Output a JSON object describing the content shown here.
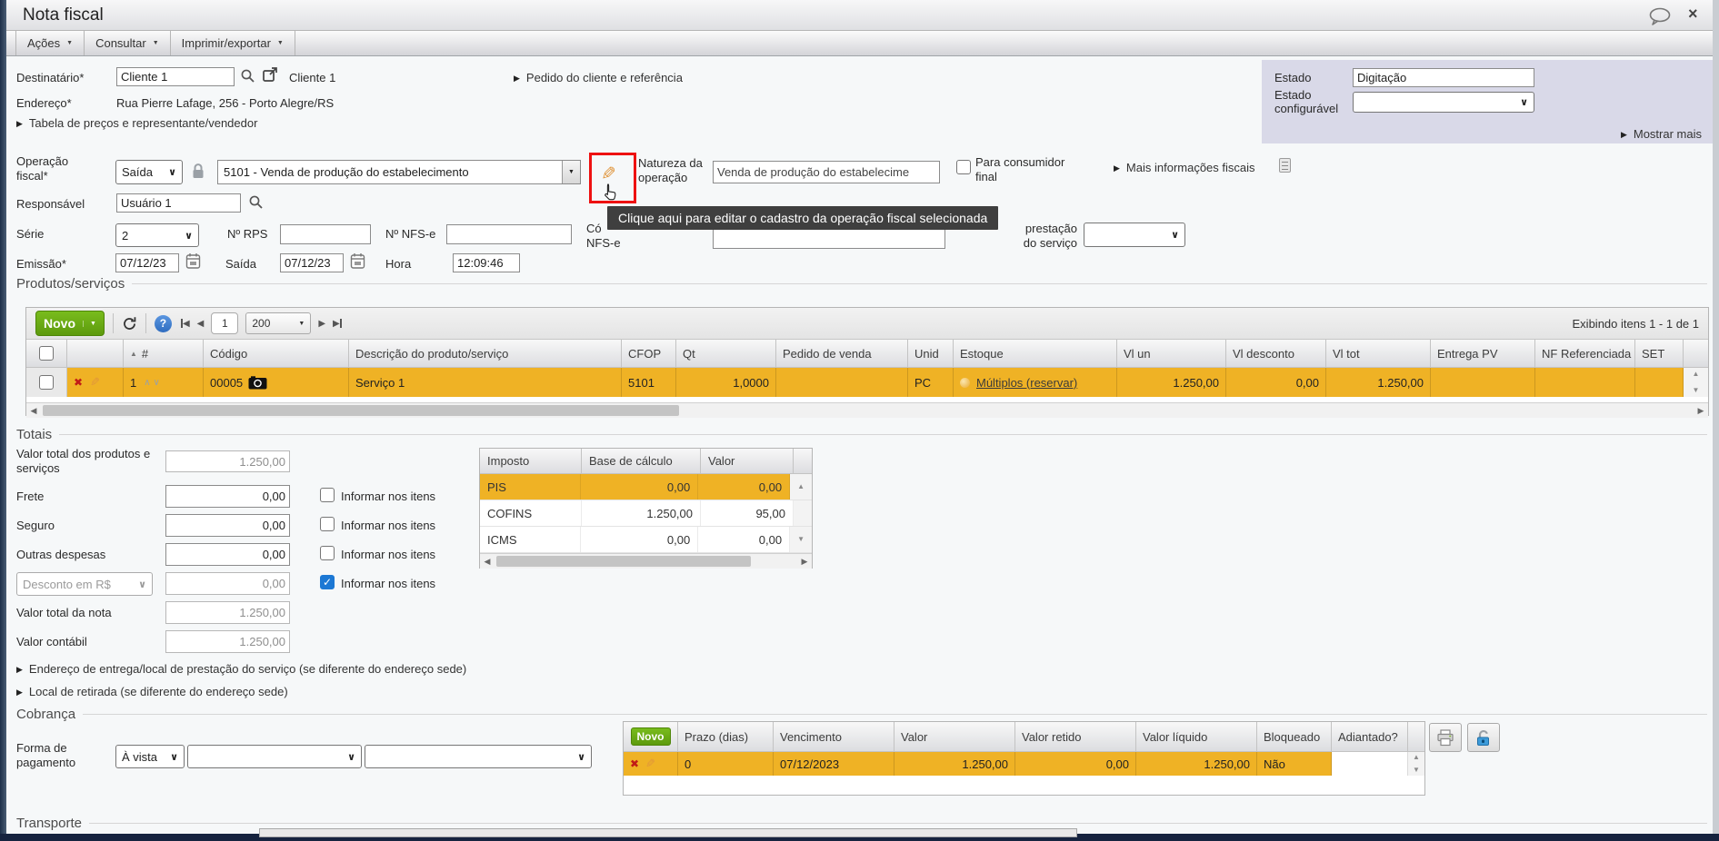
{
  "window": {
    "title": "Nota fiscal",
    "close": "×",
    "menus": [
      "Ações",
      "Consultar",
      "Imprimir/exportar"
    ]
  },
  "header": {
    "destinatario_label": "Destinatário*",
    "destinatario_value": "Cliente 1",
    "destinatario_name": "Cliente 1",
    "pedido_link": "Pedido do cliente e referência",
    "endereco_label": "Endereço*",
    "endereco_value": "Rua Pierre Lafage, 256 - Porto Alegre/RS",
    "tabela_link": "Tabela de preços e representante/vendedor",
    "estado_label": "Estado",
    "estado_value": "Digitação",
    "estado_config_label": "Estado configurável",
    "mostrar_mais": "Mostrar mais"
  },
  "fiscal": {
    "operacao_label": "Operação fiscal*",
    "tipo_value": "Saída",
    "operacao_value": "5101 - Venda de produção do estabelecimento",
    "natureza_label": "Natureza da operação",
    "natureza_value": "Venda de produção do estabelecime",
    "consumidor_label": "Para consumidor final",
    "mais_info_link": "Mais informações fiscais",
    "tooltip": "Clique aqui para editar o cadastro da operação fiscal selecionada",
    "responsavel_label": "Responsável",
    "responsavel_value": "Usuário 1",
    "serie_label": "Série",
    "serie_value": "2",
    "rps_label": "Nº RPS",
    "rps_value": "",
    "nfse_label": "Nº NFS-e",
    "nfse_value": "",
    "codigo_label_line1": "Có",
    "codigo_label_line2": "NFS-e",
    "codigo_value": "",
    "prestacao_label_line1": "prestação",
    "prestacao_label_line2": "do serviço",
    "emissao_label": "Emissão*",
    "emissao_value": "07/12/23",
    "saida_label": "Saída",
    "saida_value": "07/12/23",
    "hora_label": "Hora",
    "hora_value": "12:09:46"
  },
  "produtos": {
    "legend": "Produtos/serviços",
    "novo_label": "Novo",
    "page": "1",
    "page_size": "200",
    "exibindo": "Exibindo itens 1 - 1 de 1",
    "num_header": "#",
    "columns": [
      "Código",
      "Descrição do produto/serviço",
      "CFOP",
      "Qt",
      "Pedido de venda",
      "Unid",
      "Estoque",
      "Vl un",
      "Vl desconto",
      "Vl tot",
      "Entrega PV",
      "NF Referenciada",
      "SET"
    ],
    "row": {
      "num": "1",
      "codigo": "00005",
      "descricao": "Serviço 1",
      "cfop": "5101",
      "qt": "1,0000",
      "pedido": "",
      "unid": "PC",
      "estoque_link": "Múltiplos (reservar)",
      "vl_un": "1.250,00",
      "vl_desconto": "0,00",
      "vl_tot": "1.250,00",
      "entrega_pv": "",
      "nf_ref": "",
      "set": ""
    }
  },
  "totais": {
    "legend": "Totais",
    "valor_total_produtos_label": "Valor total dos produtos e serviços",
    "valor_total_produtos": "1.250,00",
    "frete_label": "Frete",
    "frete": "0,00",
    "seguro_label": "Seguro",
    "seguro": "0,00",
    "outras_label": "Outras despesas",
    "outras": "0,00",
    "desconto_label": "Desconto em R$",
    "desconto": "0,00",
    "informar_label": "Informar nos itens",
    "valor_total_nota_label": "Valor total da nota",
    "valor_total_nota": "1.250,00",
    "valor_contabil_label": "Valor contábil",
    "valor_contabil": "1.250,00"
  },
  "impostos": {
    "columns": [
      "Imposto",
      "Base de cálculo",
      "Valor"
    ],
    "rows": [
      [
        "PIS",
        "0,00",
        "0,00"
      ],
      [
        "COFINS",
        "1.250,00",
        "95,00"
      ],
      [
        "ICMS",
        "0,00",
        "0,00"
      ]
    ]
  },
  "links": {
    "entrega": "Endereço de entrega/local de prestação do serviço (se diferente do endereço sede)",
    "retirada": "Local de retirada (se diferente do endereço sede)"
  },
  "cobranca": {
    "legend": "Cobrança",
    "forma_label": "Forma de pagamento",
    "forma_value": "À vista",
    "novo_label": "Novo",
    "columns": [
      "Prazo (dias)",
      "Vencimento",
      "Valor",
      "Valor retido",
      "Valor líquido",
      "Bloqueado",
      "Adiantado?"
    ],
    "row": [
      "0",
      "07/12/2023",
      "1.250,00",
      "0,00",
      "1.250,00",
      "Não",
      ""
    ]
  },
  "transporte": {
    "legend": "Transporte"
  }
}
